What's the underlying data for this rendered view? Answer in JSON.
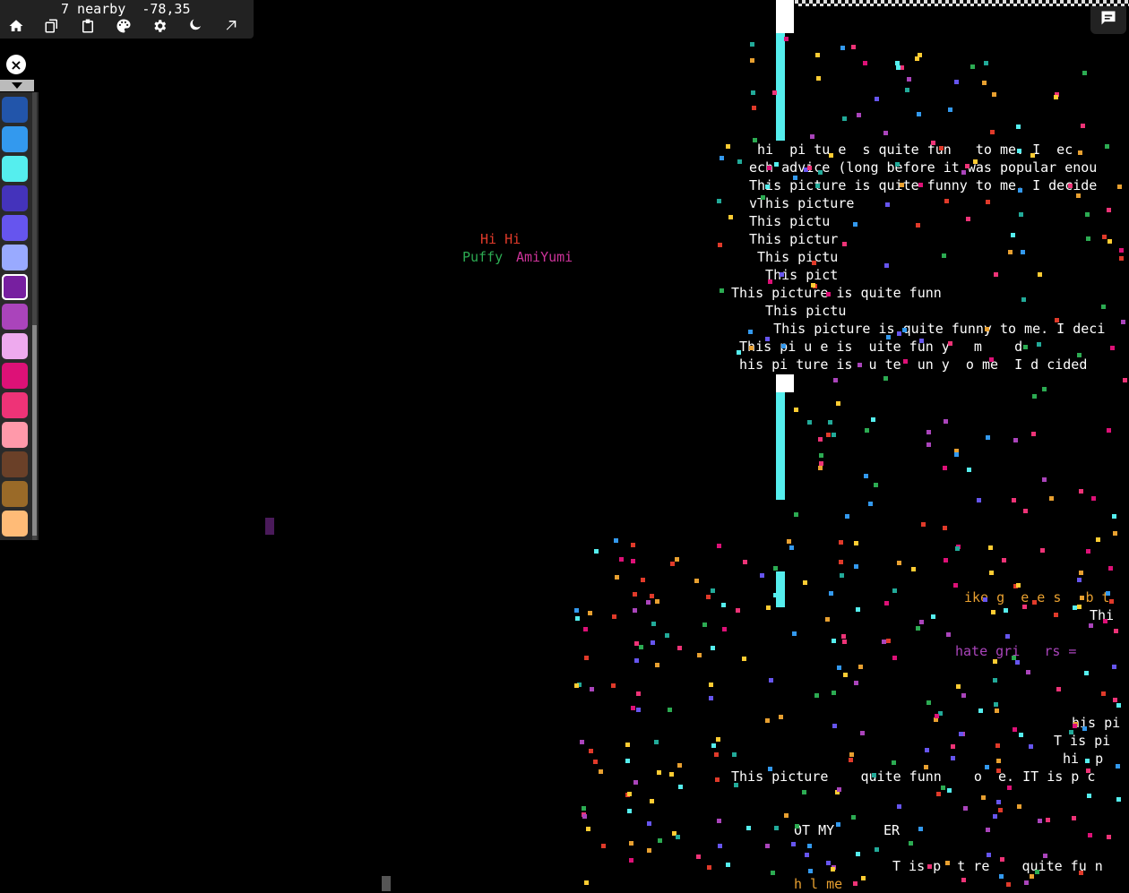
{
  "status": {
    "nearby": "7 nearby",
    "coords": "-78,35"
  },
  "toolbar": {
    "tools": [
      {
        "name": "home-icon",
        "label": "home"
      },
      {
        "name": "copy-icon",
        "label": "copy"
      },
      {
        "name": "paste-icon",
        "label": "paste"
      },
      {
        "name": "palette-icon",
        "label": "palette"
      },
      {
        "name": "gear-icon",
        "label": "settings"
      },
      {
        "name": "moon-icon",
        "label": "theme"
      },
      {
        "name": "arrow-icon",
        "label": "teleport"
      }
    ]
  },
  "palette": {
    "colors": [
      "#2255aa",
      "#3399ee",
      "#55eeee",
      "#4433bb",
      "#6655ee",
      "#99aaff",
      "#771fa0",
      "#aa44bb",
      "#eeaaee",
      "#dd1177",
      "#ee3377",
      "#ff99aa",
      "#6a4028",
      "#9a6a28",
      "#ffbb77"
    ],
    "selected_index": 6
  },
  "canvas_text": {
    "hi_hi": "Hi Hi",
    "puffy": "Puffy",
    "amiyumi": "AmiYumi",
    "lines_top": [
      " hi  pi tu e  s quite fun   to me. I  ec",
      "ech advice (long before it was popular enou",
      "This picture is quite funny to me. I decide",
      "vThis picture",
      "This pictu",
      "This pictur",
      " This pictu",
      "  This pict",
      "This picture is quite funn",
      "  This pictu",
      "   This picture is quite funny to me. I deci",
      " This pi u e is  uite fun y   m    d    ",
      " his pi ture is  u te  un y  o me  I d cided"
    ],
    "lines_bottom": [
      "ike g  e e s   b t",
      "Thi",
      "hate gri   rs =",
      "his pi",
      "T is pi",
      "hi  p",
      "This picture    quite funn    o  e. IT is p c",
      "OT MY",
      "ER",
      "T is p  t re    quite fu n",
      "h l me"
    ]
  }
}
